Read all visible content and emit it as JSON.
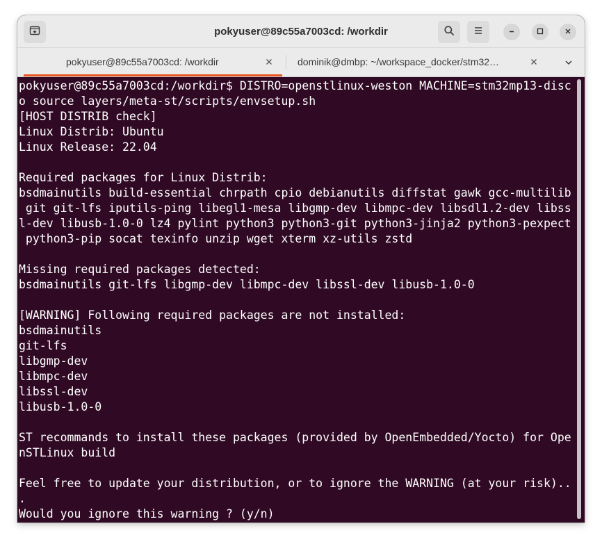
{
  "window": {
    "title": "pokyuser@89c55a7003cd: /workdir"
  },
  "headerbar": {
    "new_tab_icon": "new-tab-icon",
    "search_icon": "search-icon",
    "menu_icon": "hamburger-menu-icon",
    "minimize_icon": "minimize-icon",
    "maximize_icon": "maximize-icon",
    "close_icon": "close-icon"
  },
  "tabs": [
    {
      "label": "pokyuser@89c55a7003cd: /workdir",
      "active": true
    },
    {
      "label": "dominik@dmbp: ~/workspace_docker/stm32…",
      "active": false
    }
  ],
  "colors": {
    "terminal_bg": "#300a24",
    "terminal_fg": "#ffffff",
    "tab_accent": "#e95420",
    "headerbar_bg": "#ebebeb"
  },
  "terminal": {
    "lines": [
      "pokyuser@89c55a7003cd:/workdir$ DISTRO=openstlinux-weston MACHINE=stm32mp13-disc",
      "o source layers/meta-st/scripts/envsetup.sh",
      "[HOST DISTRIB check]",
      "Linux Distrib: Ubuntu",
      "Linux Release: 22.04",
      "",
      "Required packages for Linux Distrib:",
      "bsdmainutils build-essential chrpath cpio debianutils diffstat gawk gcc-multilib",
      " git git-lfs iputils-ping libegl1-mesa libgmp-dev libmpc-dev libsdl1.2-dev libss",
      "l-dev libusb-1.0-0 lz4 pylint python3 python3-git python3-jinja2 python3-pexpect",
      " python3-pip socat texinfo unzip wget xterm xz-utils zstd",
      "",
      "Missing required packages detected:",
      "bsdmainutils git-lfs libgmp-dev libmpc-dev libssl-dev libusb-1.0-0",
      "",
      "[WARNING] Following required packages are not installed:",
      "bsdmainutils",
      "git-lfs",
      "libgmp-dev",
      "libmpc-dev",
      "libssl-dev",
      "libusb-1.0-0",
      "",
      "ST recommands to install these packages (provided by OpenEmbedded/Yocto) for Ope",
      "nSTLinux build",
      "",
      "Feel free to update your distribution, or to ignore the WARNING (at your risk)..",
      ".",
      "Would you ignore this warning ? (y/n)"
    ]
  }
}
